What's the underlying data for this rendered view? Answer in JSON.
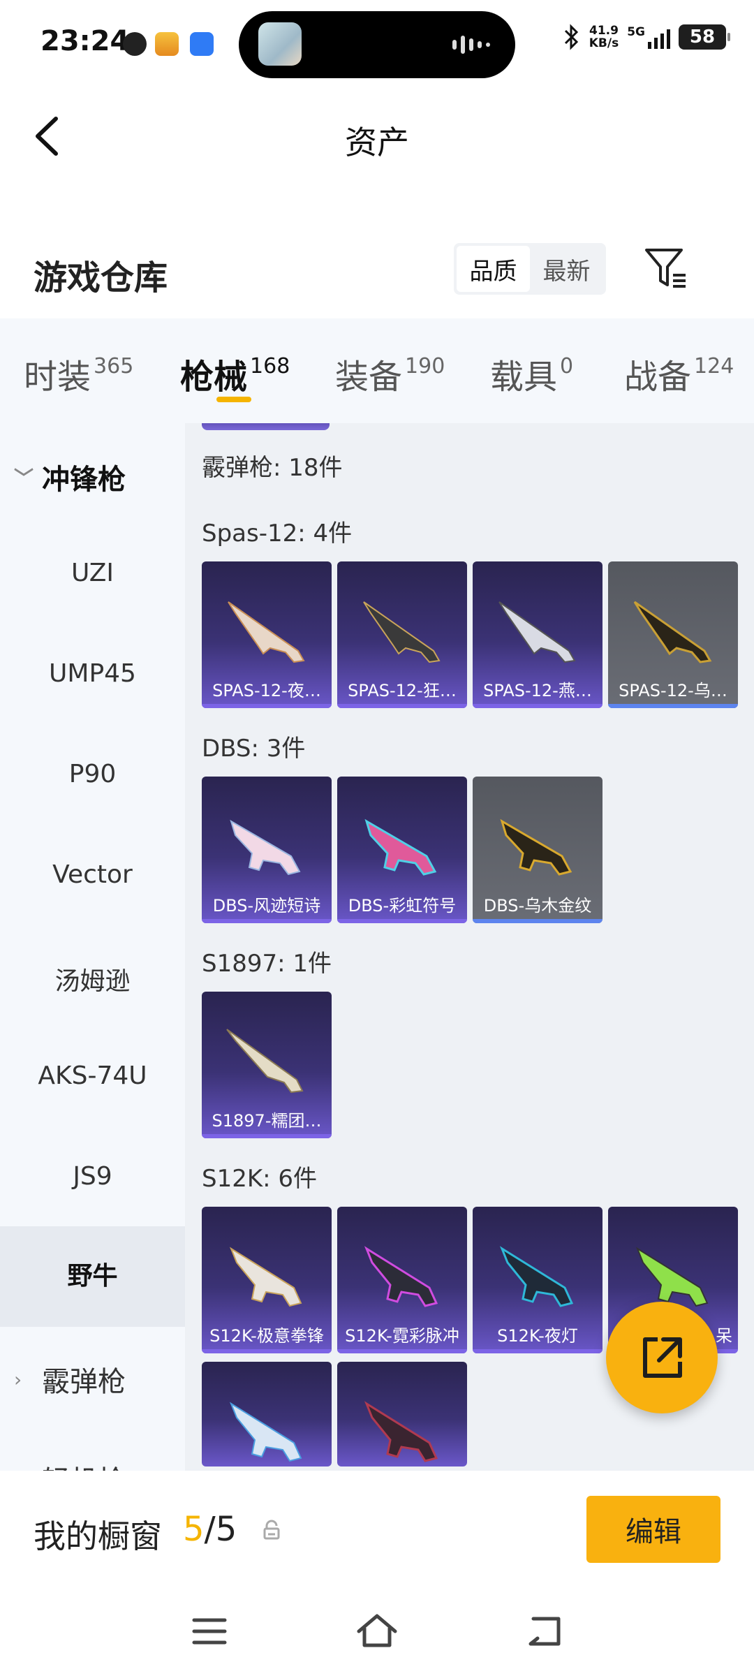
{
  "status_bar": {
    "time": "23:24",
    "net_speed_value": "41.9",
    "net_speed_unit": "KB/s",
    "network": "5G",
    "battery": "58"
  },
  "header": {
    "title": "资产",
    "back_icon": "chevron-left-icon"
  },
  "section": {
    "title": "游戏仓库",
    "sort_options": [
      "品质",
      "最新"
    ],
    "sort_selected": "品质",
    "filter_icon": "filter-icon"
  },
  "tabs": [
    {
      "label": "时装",
      "count": "365"
    },
    {
      "label": "枪械",
      "count": "168",
      "active": true
    },
    {
      "label": "装备",
      "count": "190"
    },
    {
      "label": "载具",
      "count": "0"
    },
    {
      "label": "战备",
      "count": "124"
    }
  ],
  "sidebar": {
    "group_expanded": "冲锋枪",
    "items": [
      "UZI",
      "UMP45",
      "P90",
      "Vector",
      "汤姆逊",
      "AKS-74U",
      "JS9",
      "野牛"
    ],
    "active_item": "野牛",
    "group_collapsed": "霰弹枪",
    "group_partial": "轻机枪"
  },
  "content": {
    "group_header": "霰弹枪: 18件",
    "categories": [
      {
        "header": "Spas-12: 4件",
        "items": [
          {
            "label": "SPAS-12-夜…",
            "rarity": "purple"
          },
          {
            "label": "SPAS-12-狂…",
            "rarity": "purple"
          },
          {
            "label": "SPAS-12-燕…",
            "rarity": "purple"
          },
          {
            "label": "SPAS-12-乌…",
            "rarity": "blue"
          }
        ]
      },
      {
        "header": "DBS: 3件",
        "items": [
          {
            "label": "DBS-风迹短诗",
            "rarity": "purple"
          },
          {
            "label": "DBS-彩虹符号",
            "rarity": "purple"
          },
          {
            "label": "DBS-乌木金纹",
            "rarity": "blue"
          }
        ]
      },
      {
        "header": "S1897: 1件",
        "items": [
          {
            "label": "S1897-糯团…",
            "rarity": "purple"
          }
        ]
      },
      {
        "header": "S12K: 6件",
        "items": [
          {
            "label": "S12K-极意拳锋",
            "rarity": "purple"
          },
          {
            "label": "S12K-霓彩脉冲",
            "rarity": "purple"
          },
          {
            "label": "S12K-夜灯",
            "rarity": "purple"
          },
          {
            "label": "呆",
            "rarity": "purple"
          },
          {
            "label": "",
            "rarity": "purple"
          },
          {
            "label": "",
            "rarity": "purple"
          }
        ]
      }
    ]
  },
  "fab": {
    "icon": "share-external-icon"
  },
  "showcase": {
    "label": "我的橱窗",
    "current": "5",
    "separator": "/",
    "total": "5",
    "edit_label": "编辑",
    "lock_icon": "lock-icon"
  },
  "nav_bar": {
    "icons": [
      "menu-icon",
      "home-icon",
      "back-icon"
    ]
  },
  "colors": {
    "accent": "#f9b10f",
    "purple_card": "#3b3275",
    "grey_card": "#5d6068"
  }
}
